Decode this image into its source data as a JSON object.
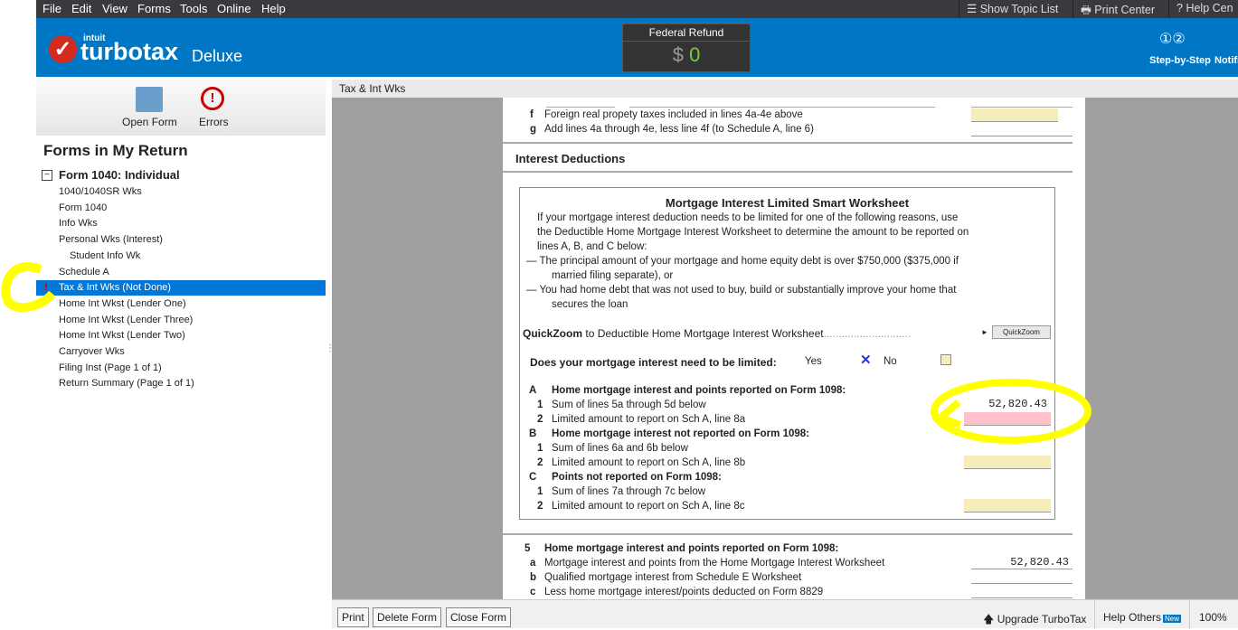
{
  "menu": [
    "File",
    "Edit",
    "View",
    "Forms",
    "Tools",
    "Online",
    "Help"
  ],
  "topbar": {
    "topic_list": "Show Topic List",
    "print_center": "Print Center",
    "help_center": "Help Cen"
  },
  "brand": {
    "intuit": "intuit",
    "name": "turbotax",
    "edition": "Deluxe",
    "color": "#0077c5"
  },
  "refund": {
    "label": "Federal Refund",
    "currency": "$",
    "amount": "0"
  },
  "header_right": {
    "step": "Step-by-Step",
    "notif": "Notifi"
  },
  "sidebar": {
    "open_form": "Open Form",
    "errors": "Errors",
    "title": "Forms in My Return",
    "group": "Form 1040:  Individual",
    "items": [
      "1040/1040SR Wks",
      "Form 1040",
      "Info Wks",
      "Personal Wks (Interest)",
      "Student Info Wk",
      "Schedule A",
      "Tax & Int Wks (Not Done)",
      "Home Int Wkst (Lender One)",
      "Home Int Wkst (Lender Three)",
      "Home Int Wkst (Lender Two)",
      "Carryover Wks",
      "Filing Inst (Page 1 of 1)",
      "Return Summary (Page 1 of 1)"
    ],
    "selected_index": 6
  },
  "tab": "Tax & Int Wks",
  "form": {
    "f_letter": "f",
    "f_text": "Foreign real propety taxes included in lines 4a-4e above",
    "g_letter": "g",
    "g_text": "Add lines 4a through 4e, less line 4f (to Schedule A, line 6)",
    "section": "Interest Deductions",
    "ws_title": "Mortgage Interest Limited Smart Worksheet",
    "ws_intro": [
      "If your mortgage interest deduction needs to be limited for one of the following reasons, use",
      "the Deductible Home Mortgage Interest Worksheet to determine the amount to be reported on",
      "lines A, B, and C below:"
    ],
    "ws_b1": [
      "— The principal amount of your mortgage and home equity debt is over $750,000 ($375,000 if",
      "married filing separate), or"
    ],
    "ws_b2": [
      "— You had home debt that was not used to buy, build or substantially improve your home that",
      "secures the loan"
    ],
    "qz_bold": "QuickZoom",
    "qz_text": "to Deductible Home Mortgage Interest Worksheet",
    "qz_btn": "QuickZoom",
    "question": "Does your mortgage interest need to be limited:",
    "yes": "Yes",
    "no": "No",
    "yes_checked": true,
    "A": "A",
    "A_title": "Home mortgage interest and points reported on Form 1098:",
    "A1": "Sum of lines 5a through 5d below",
    "A1_val": "52,820.43",
    "A2": "Limited amount to report on Sch A, line 8a",
    "B": "B",
    "B_title": "Home mortgage interest not reported on Form 1098:",
    "B1": "Sum of lines 6a and 6b below",
    "B2": "Limited amount to report on Sch A, line 8b",
    "C": "C",
    "C_title": "Points not reported on Form 1098:",
    "C1": "Sum of lines 7a through 7c below",
    "C2": "Limited amount to report on Sch A, line 8c",
    "n5": "5",
    "n5_title": "Home mortgage interest and points reported on Form 1098:",
    "a5": "Mortgage interest and points from the Home Mortgage Interest Worksheet",
    "a5_val": "52,820.43",
    "b5": "Qualified mortgage interest from Schedule E  Worksheet",
    "c5": "Less home mortgage interest/points deducted on Form 8829",
    "one": "1",
    "two": "2",
    "la": "a",
    "lb": "b",
    "lc": "c"
  },
  "bottom": {
    "print": "Print",
    "delete": "Delete Form",
    "close": "Close Form",
    "upgrade": "Upgrade TurboTax",
    "help_others": "Help Others",
    "new": "New",
    "zoom": "100%"
  },
  "annotation_color": "#ffff00"
}
